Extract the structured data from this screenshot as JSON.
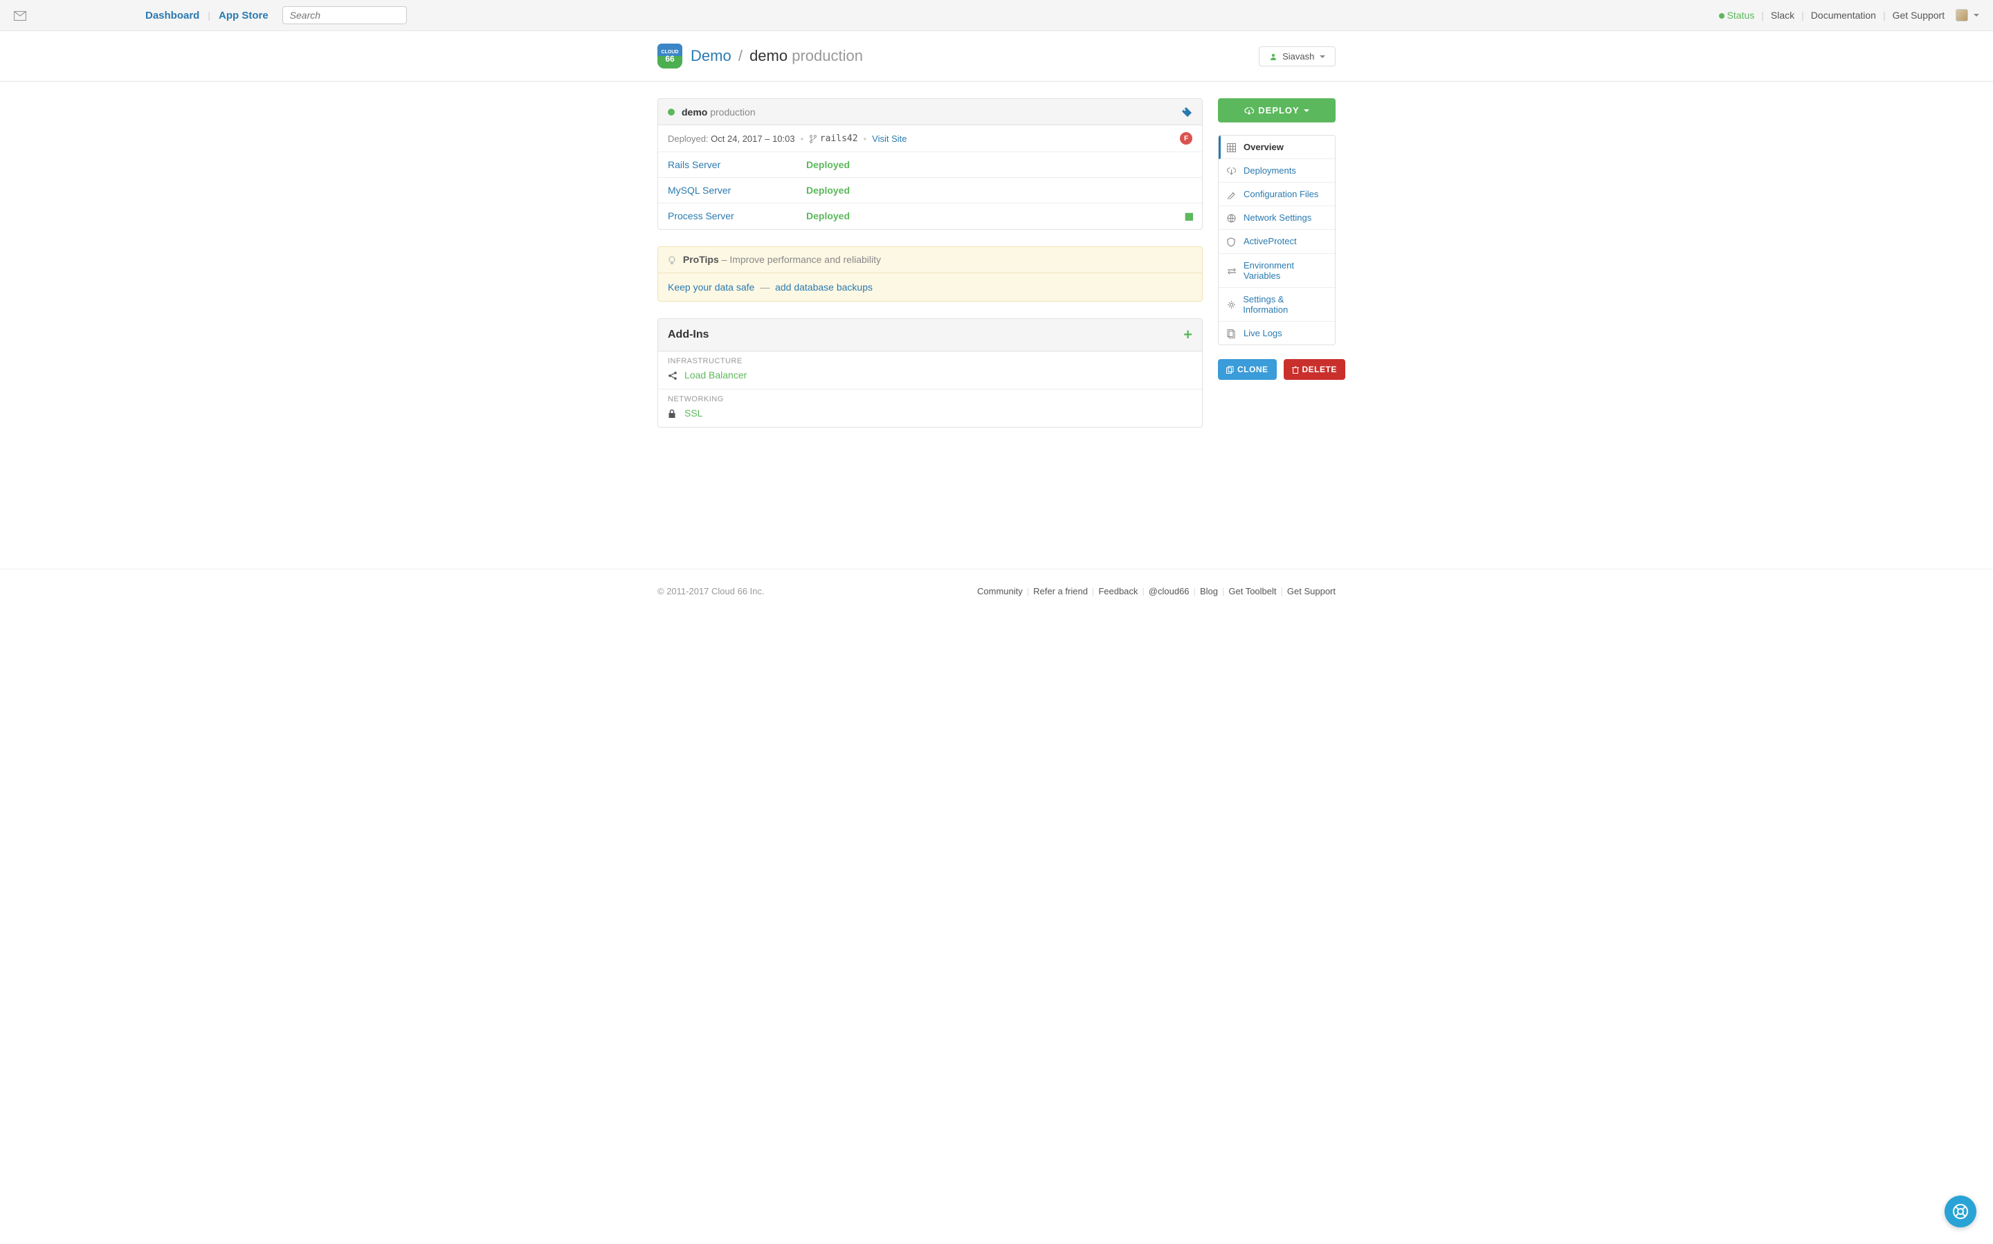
{
  "topnav": {
    "dashboard": "Dashboard",
    "appstore": "App Store",
    "search_placeholder": "Search",
    "status": "Status",
    "slack": "Slack",
    "docs": "Documentation",
    "support": "Get Support"
  },
  "pagehead": {
    "org": "Demo",
    "app": "demo",
    "env": "production",
    "user": "Siavash"
  },
  "stack": {
    "name": "demo",
    "env": "production",
    "deployed_prefix": "Deployed:",
    "deployed_at": "Oct 24, 2017 – 10:03",
    "framework": "rails42",
    "visit": "Visit Site",
    "fail_badge": "F",
    "servers": [
      {
        "name": "Rails Server",
        "status": "Deployed",
        "pausable": false
      },
      {
        "name": "MySQL Server",
        "status": "Deployed",
        "pausable": false
      },
      {
        "name": "Process Server",
        "status": "Deployed",
        "pausable": true
      }
    ]
  },
  "protips": {
    "title": "ProTips",
    "subtitle": "– Improve performance and reliability",
    "tip_main": "Keep your data safe",
    "tip_sep": "—",
    "tip_action": "add database backups"
  },
  "addins": {
    "title": "Add-Ins",
    "sections": [
      {
        "label": "INFRASTRUCTURE",
        "item": "Load Balancer",
        "icon": "share"
      },
      {
        "label": "NETWORKING",
        "item": "SSL",
        "icon": "lock"
      }
    ]
  },
  "sidebar": {
    "deploy": "DEPLOY",
    "items": [
      {
        "label": "Overview",
        "active": true
      },
      {
        "label": "Deployments",
        "active": false
      },
      {
        "label": "Configuration Files",
        "active": false
      },
      {
        "label": "Network Settings",
        "active": false
      },
      {
        "label": "ActiveProtect",
        "active": false
      },
      {
        "label": "Environment Variables",
        "active": false
      },
      {
        "label": "Settings & Information",
        "active": false
      },
      {
        "label": "Live Logs",
        "active": false
      }
    ],
    "clone": "CLONE",
    "delete": "DELETE"
  },
  "footer": {
    "copyright": "© 2011-2017 Cloud 66 Inc.",
    "links": [
      "Community",
      "Refer a friend",
      "Feedback",
      "@cloud66",
      "Blog",
      "Get Toolbelt",
      "Get Support"
    ]
  }
}
